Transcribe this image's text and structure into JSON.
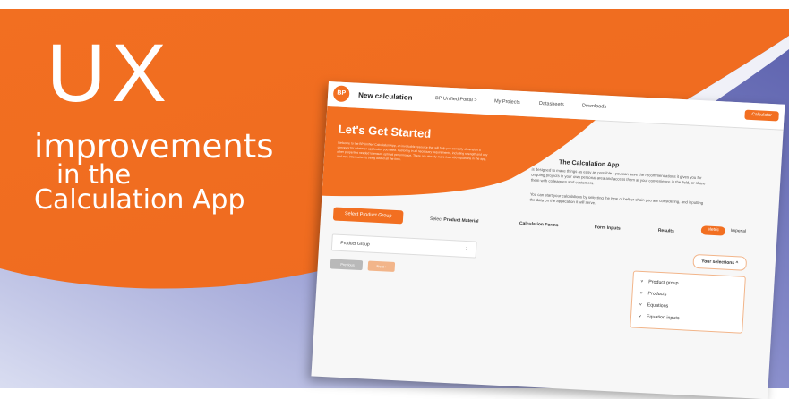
{
  "banner": {
    "headline": "UX",
    "line2": "improvements",
    "line3": "in the",
    "line4": "Calculation App",
    "colors": {
      "orange": "#f26f21",
      "purple": "#6267b2",
      "white": "#ffffff"
    }
  },
  "app": {
    "logo_text": "BP",
    "nav": {
      "title": "New calculation",
      "items": [
        "BP Unified Portal >",
        "My Projects",
        "Datasheets",
        "Downloads"
      ],
      "button": "Calculator"
    },
    "hero": {
      "title": "Let's Get Started",
      "intro": "Welcome to the BP Unified Calculation App, an invaluable resource that will help you correctly dimension a conveyor for whatever application you need. Factoring in all necessary requirements, including strength and any other properties needed to ensure optimal performance. There are already more than 400 equations in the app, and new information is being added all the time."
    },
    "about": {
      "title_bold": "The Calculation App",
      "title_rest": " is designed to make things as easy as possible - you can save the recommendations it gives you for ongoing projects in your own personal area and access them at your convenience in the field, or share them with colleagues and customers.",
      "text2": "You can start your calculations by selecting the type of belt or chain you are considering, and inputting the data on the application it will serve."
    },
    "steps": {
      "active": "Select Product Group",
      "step2_prefix": "Select ",
      "step2_bold": "Product Material",
      "step3": "Calculation Forms",
      "step4": "Form Inputs",
      "step5": "Results"
    },
    "units": {
      "metric": "Metric",
      "imperial": "Imperial"
    },
    "product_field": {
      "label": "Product Group",
      "chevron": "›"
    },
    "buttons": {
      "previous": "‹  Previous",
      "next": "Next  ›"
    },
    "selections": {
      "label": "Your selections  ^",
      "items": [
        "Product group",
        "Products",
        "Equations",
        "Equation inputs"
      ],
      "chevron": "˅"
    }
  }
}
